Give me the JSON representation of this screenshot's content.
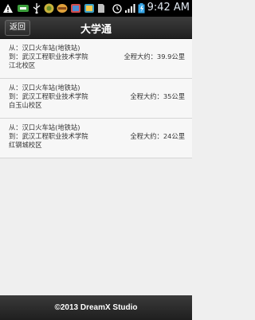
{
  "status_bar": {
    "time": "9:42 AM",
    "icons": [
      "notification-icon",
      "alert-icon",
      "usb-icon",
      "app-icon",
      "app-icon",
      "app-icon",
      "sd-card-icon",
      "battery-status-icon",
      "alarm-icon",
      "signal-icon",
      "battery-icon"
    ]
  },
  "header": {
    "back_label": "返回",
    "title": "大学通"
  },
  "routes": [
    {
      "from": "从：汉口火车站(地铁站)",
      "to": "到：武汉工程职业技术学院",
      "campus": "江北校区",
      "distance": "全程大约：39.9公里"
    },
    {
      "from": "从：汉口火车站(地铁站)",
      "to": "到：武汉工程职业技术学院",
      "campus": "白玉山校区",
      "distance": "全程大约：35公里"
    },
    {
      "from": "从：汉口火车站(地铁站)",
      "to": "到：武汉工程职业技术学院",
      "campus": "红钢城校区",
      "distance": "全程大约：24公里"
    }
  ],
  "footer": {
    "text": "©2013 DreamX Studio"
  },
  "colors": {
    "background": "#efefef",
    "bar": "#2a2a2a",
    "row": "#f7f7f7"
  }
}
